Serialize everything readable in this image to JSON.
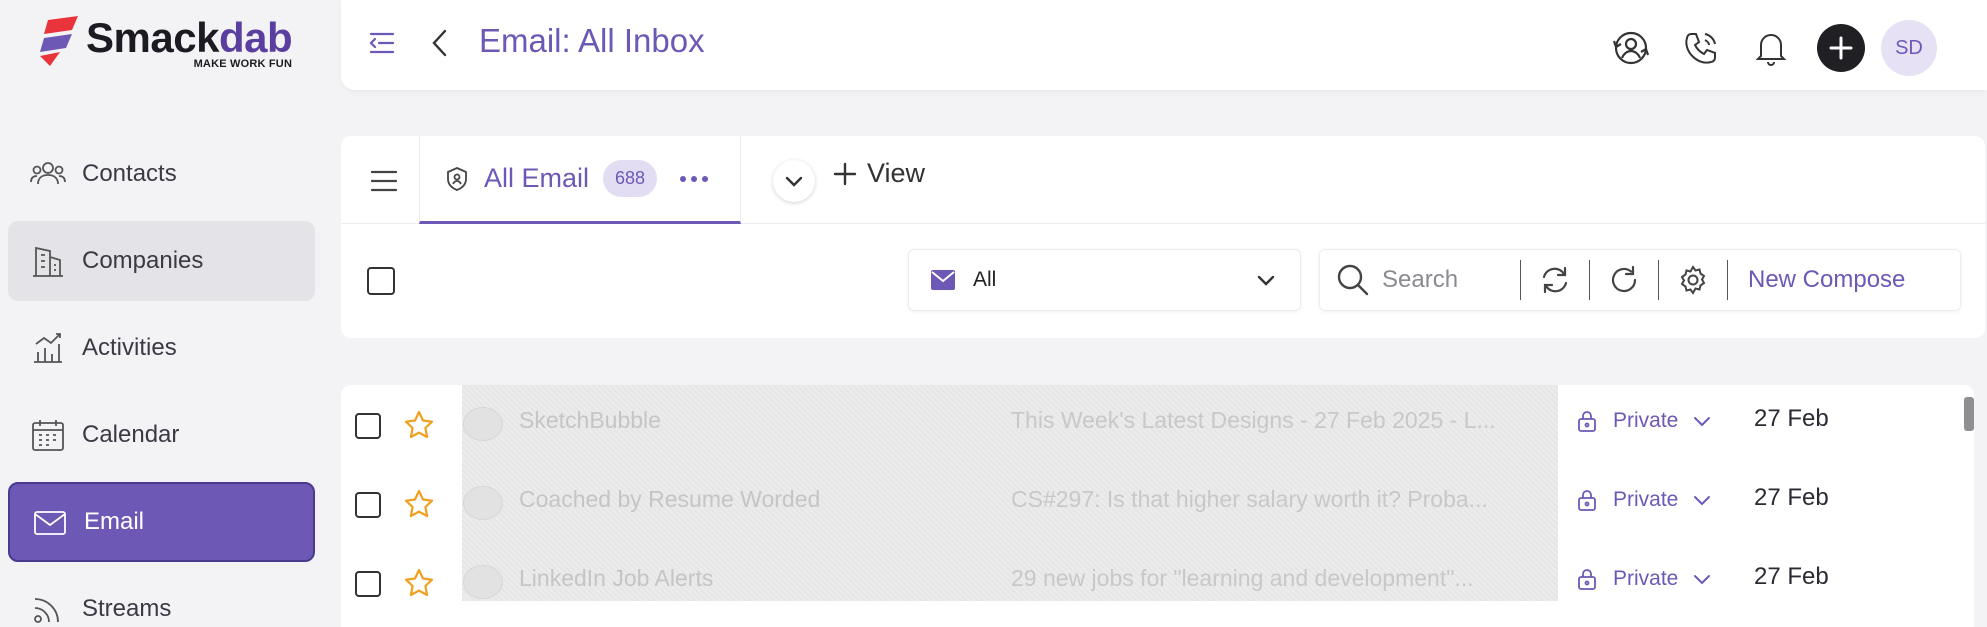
{
  "brand": {
    "name_part1": "Smack",
    "name_part2": "dab",
    "tagline": "MAKE WORK FUN"
  },
  "sidebar": {
    "items": [
      {
        "label": "Contacts",
        "icon": "contacts-icon"
      },
      {
        "label": "Companies",
        "icon": "building-icon"
      },
      {
        "label": "Activities",
        "icon": "activities-icon"
      },
      {
        "label": "Calendar",
        "icon": "calendar-icon"
      },
      {
        "label": "Email",
        "icon": "mail-icon"
      },
      {
        "label": "Streams",
        "icon": "streams-icon"
      }
    ]
  },
  "header": {
    "title": "Email: All Inbox",
    "avatar_initials": "SD"
  },
  "tabs": {
    "active_label": "All Email",
    "active_count": "688",
    "add_view_label": "View"
  },
  "toolbar": {
    "filter_value": "All",
    "search_placeholder": "Search",
    "compose_label": "New Compose"
  },
  "emails": [
    {
      "sender": "SketchBubble",
      "subject": "This Week's Latest Designs - 27 Feb 2025 - L...",
      "visibility": "Private",
      "date": "27 Feb"
    },
    {
      "sender": "Coached by Resume Worded",
      "subject": "CS#297: Is that higher salary worth it? Proba...",
      "visibility": "Private",
      "date": "27 Feb"
    },
    {
      "sender": "LinkedIn Job Alerts",
      "subject": "29 new jobs for \"learning and development\"...",
      "visibility": "Private",
      "date": "27 Feb"
    }
  ],
  "colors": {
    "accent": "#6e58b6",
    "star": "#f0a020",
    "logo_red": "#e8343a"
  }
}
